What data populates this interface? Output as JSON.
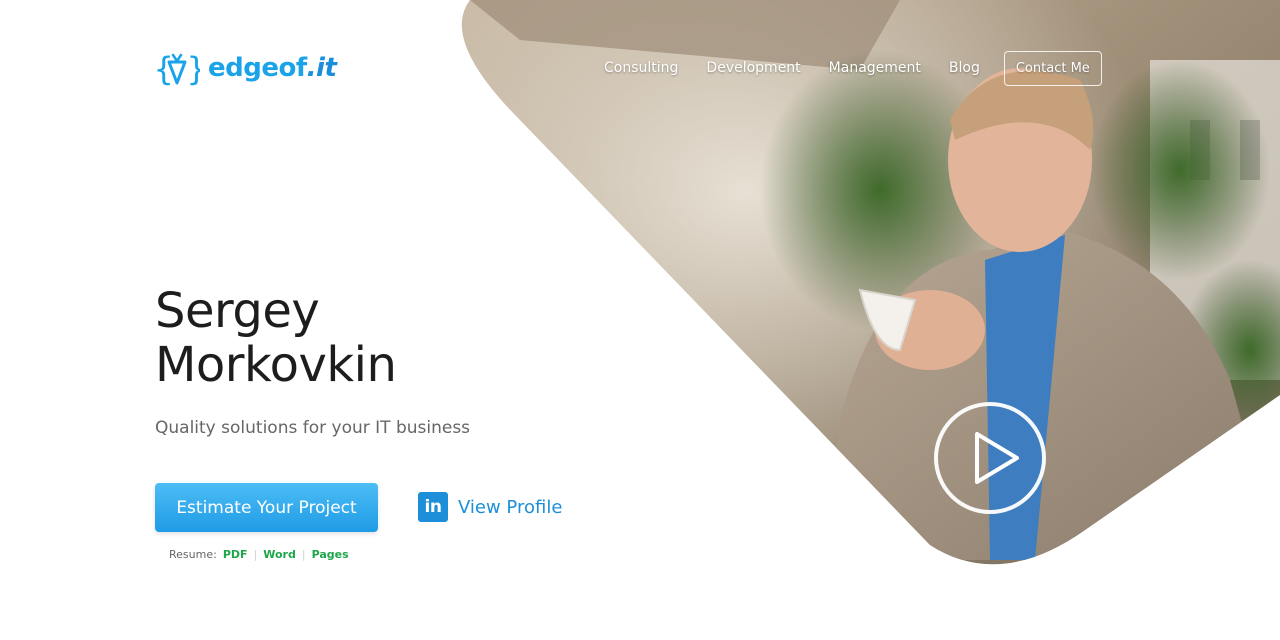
{
  "brand": {
    "logo_main": "edgeof",
    "logo_suffix": ".it",
    "accent_color": "#1aa3e8"
  },
  "nav": {
    "items": [
      "Consulting",
      "Development",
      "Management",
      "Blog"
    ],
    "contact_label": "Contact Me"
  },
  "hero": {
    "first_name": "Sergey",
    "last_name": "Morkovkin",
    "tagline": "Quality solutions for your IT business",
    "estimate_label": "Estimate Your Project",
    "profile_icon_text": "in",
    "profile_label": "View Profile",
    "play_icon": "play-icon"
  },
  "resume": {
    "label": "Resume:",
    "links": [
      "PDF",
      "Word",
      "Pages"
    ],
    "link_color": "#1ea64a"
  }
}
